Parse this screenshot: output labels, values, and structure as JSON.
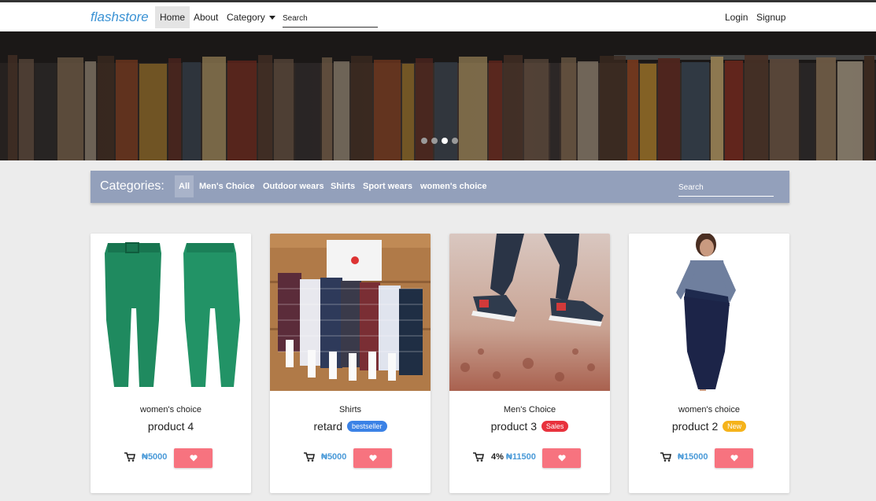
{
  "navbar": {
    "brand": "flashstore",
    "items": [
      {
        "label": "Home"
      },
      {
        "label": "About"
      },
      {
        "label": "Category"
      }
    ],
    "search_placeholder": "Search",
    "login": "Login",
    "signup": "Signup"
  },
  "hero": {
    "dots": 4,
    "active_dot": 3
  },
  "categories": {
    "title": "Categories:",
    "items": [
      {
        "label": "All"
      },
      {
        "label": "Men's Choice"
      },
      {
        "label": "Outdoor wears"
      },
      {
        "label": "Shirts"
      },
      {
        "label": "Sport wears"
      },
      {
        "label": "women's choice"
      }
    ],
    "search_placeholder": "Search"
  },
  "products": [
    {
      "category": "women's choice",
      "title": "product 4",
      "badge": "",
      "discount": "",
      "price": "₦5000",
      "image": "green-trousers"
    },
    {
      "category": "Shirts",
      "title": "retard",
      "badge": "bestseller",
      "badge_color": "#3b82e6",
      "discount": "",
      "price": "₦5000",
      "image": "checked-shirts"
    },
    {
      "category": "Men's Choice",
      "title": "product 3",
      "badge": "Sales",
      "badge_color": "#e8323d",
      "discount": "4%",
      "price": "₦11500",
      "image": "sneakers-jump"
    },
    {
      "category": "women's choice",
      "title": "product 2",
      "badge": "New",
      "badge_color": "#f5b31b",
      "discount": "",
      "price": "₦15000",
      "image": "navy-dress"
    }
  ],
  "colors": {
    "brand": "#3a92d4",
    "category_bar": "#93a0bb",
    "favorite_button": "#f7737f",
    "price": "#4a9ad8"
  },
  "icons": [
    "cart-icon",
    "heart-icon"
  ]
}
